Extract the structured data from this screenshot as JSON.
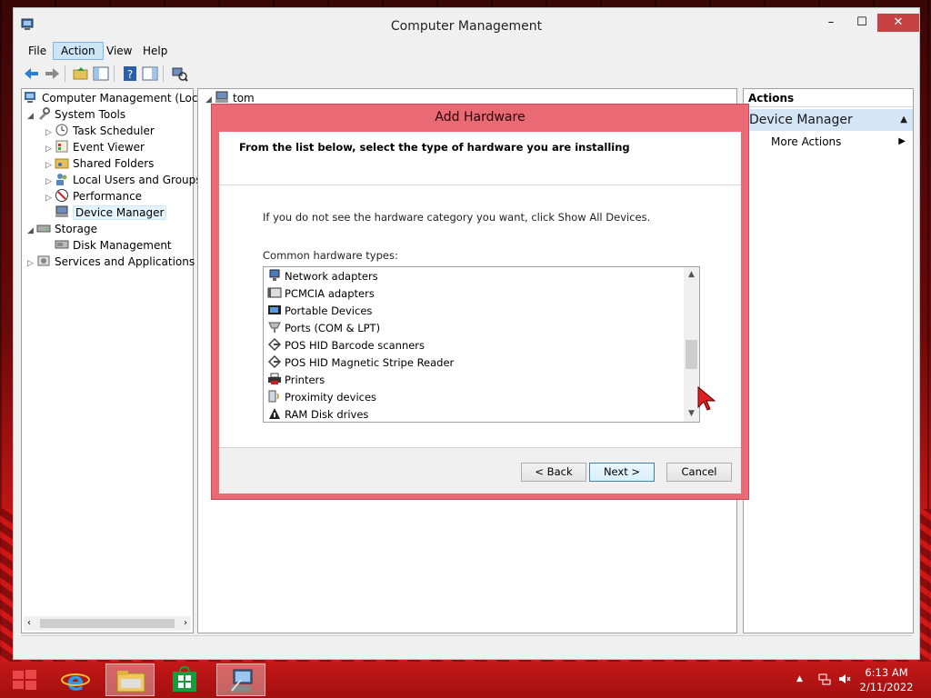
{
  "window": {
    "title": "Computer Management",
    "controls": {
      "minimize": "–",
      "maximize": "☐",
      "close": "✕"
    }
  },
  "menu": [
    "File",
    "Action",
    "View",
    "Help"
  ],
  "tree": [
    {
      "label": "Computer Management (Local",
      "level": 0,
      "toggle": "",
      "icon": "computer-management-icon"
    },
    {
      "label": "System Tools",
      "level": 1,
      "toggle": "◢",
      "icon": "system-tools-icon"
    },
    {
      "label": "Task Scheduler",
      "level": 2,
      "toggle": "▷",
      "icon": "task-scheduler-icon"
    },
    {
      "label": "Event Viewer",
      "level": 2,
      "toggle": "▷",
      "icon": "event-viewer-icon"
    },
    {
      "label": "Shared Folders",
      "level": 2,
      "toggle": "▷",
      "icon": "shared-folders-icon"
    },
    {
      "label": "Local Users and Groups",
      "level": 2,
      "toggle": "▷",
      "icon": "users-groups-icon"
    },
    {
      "label": "Performance",
      "level": 2,
      "toggle": "▷",
      "icon": "performance-icon"
    },
    {
      "label": "Device Manager",
      "level": 2,
      "toggle": "",
      "icon": "device-manager-icon",
      "selected": true
    },
    {
      "label": "Storage",
      "level": 1,
      "toggle": "◢",
      "icon": "storage-icon"
    },
    {
      "label": "Disk Management",
      "level": 2,
      "toggle": "",
      "icon": "disk-management-icon"
    },
    {
      "label": "Services and Applications",
      "level": 1,
      "toggle": "▷",
      "icon": "services-icon"
    }
  ],
  "middle": {
    "root_node": "tom"
  },
  "actions": {
    "header": "Actions",
    "section": "Device Manager",
    "items": [
      "More Actions"
    ]
  },
  "dialog": {
    "title": "Add Hardware",
    "heading": "From the list below, select the type of hardware you are installing",
    "hint": "If you do not see the hardware category you want, click Show All Devices.",
    "list_label": "Common hardware types:",
    "items": [
      {
        "label": "Network adapters",
        "icon": "network-adapter-icon"
      },
      {
        "label": "PCMCIA adapters",
        "icon": "pcmcia-icon"
      },
      {
        "label": "Portable Devices",
        "icon": "portable-device-icon"
      },
      {
        "label": "Ports (COM & LPT)",
        "icon": "port-icon"
      },
      {
        "label": "POS HID Barcode scanners",
        "icon": "pos-hid-icon"
      },
      {
        "label": "POS HID Magnetic Stripe Reader",
        "icon": "pos-hid-icon"
      },
      {
        "label": "Printers",
        "icon": "printer-icon"
      },
      {
        "label": "Proximity devices",
        "icon": "proximity-icon"
      },
      {
        "label": "RAM Disk drives",
        "icon": "ram-disk-icon"
      }
    ],
    "buttons": {
      "back": "< Back",
      "next": "Next >",
      "cancel": "Cancel"
    }
  },
  "taskbar": {
    "apps": [
      "start-icon",
      "internet-explorer-icon",
      "file-explorer-icon",
      "store-icon",
      "computer-management-icon"
    ],
    "time": "6:13 AM",
    "date": "2/11/2022"
  },
  "colors": {
    "dialog_frame": "#e96a74",
    "taskbar": "#c41818",
    "selection": "#d4e5f5"
  }
}
